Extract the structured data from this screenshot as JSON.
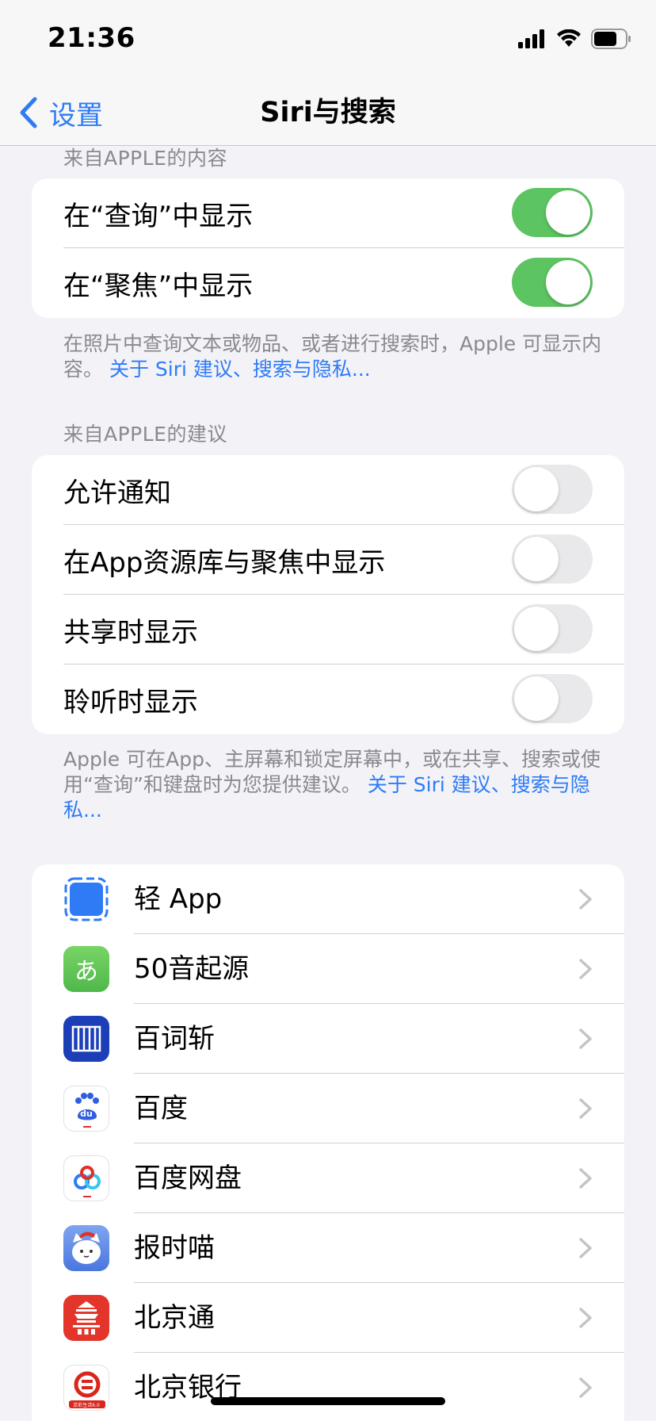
{
  "status": {
    "time": "21:36"
  },
  "nav": {
    "back_label": "设置",
    "title": "Siri与搜索"
  },
  "section1": {
    "header": "来自APPLE的内容",
    "rows": [
      {
        "label": "在“查询”中显示",
        "on": true
      },
      {
        "label": "在“聚焦”中显示",
        "on": true
      }
    ],
    "footer_text": "在照片中查询文本或物品、或者进行搜索时，Apple 可显示内容。",
    "footer_link": "关于 Siri 建议、搜索与隐私..."
  },
  "section2": {
    "header": "来自APPLE的建议",
    "rows": [
      {
        "label": "允许通知",
        "on": false
      },
      {
        "label": "在App资源库与聚焦中显示",
        "on": false
      },
      {
        "label": "共享时显示",
        "on": false
      },
      {
        "label": "聆听时显示",
        "on": false
      }
    ],
    "footer_text": "Apple 可在App、主屏幕和锁定屏幕中，或在共享、搜索或使用“查询”和键盘时为您提供建议。",
    "footer_link": "关于 Siri 建议、搜索与隐私..."
  },
  "apps": [
    {
      "label": "轻 App",
      "icon": "light-app-icon"
    },
    {
      "label": "50音起源",
      "icon": "fifty-sounds-icon",
      "glyph": "あ"
    },
    {
      "label": "百词斩",
      "icon": "baicizhan-icon"
    },
    {
      "label": "百度",
      "icon": "baidu-icon",
      "glyph": "du"
    },
    {
      "label": "百度网盘",
      "icon": "baidu-netdisk-icon"
    },
    {
      "label": "报时喵",
      "icon": "baoshimiao-icon"
    },
    {
      "label": "北京通",
      "icon": "beijingtong-icon"
    },
    {
      "label": "北京银行",
      "icon": "bank-of-beijing-icon",
      "badge_text": "京彩生活6.0"
    }
  ],
  "colors": {
    "accent": "#2f7bf5",
    "toggle_on": "#5cc461",
    "toggle_off": "#e9e9eb",
    "background": "#f2f2f7"
  }
}
